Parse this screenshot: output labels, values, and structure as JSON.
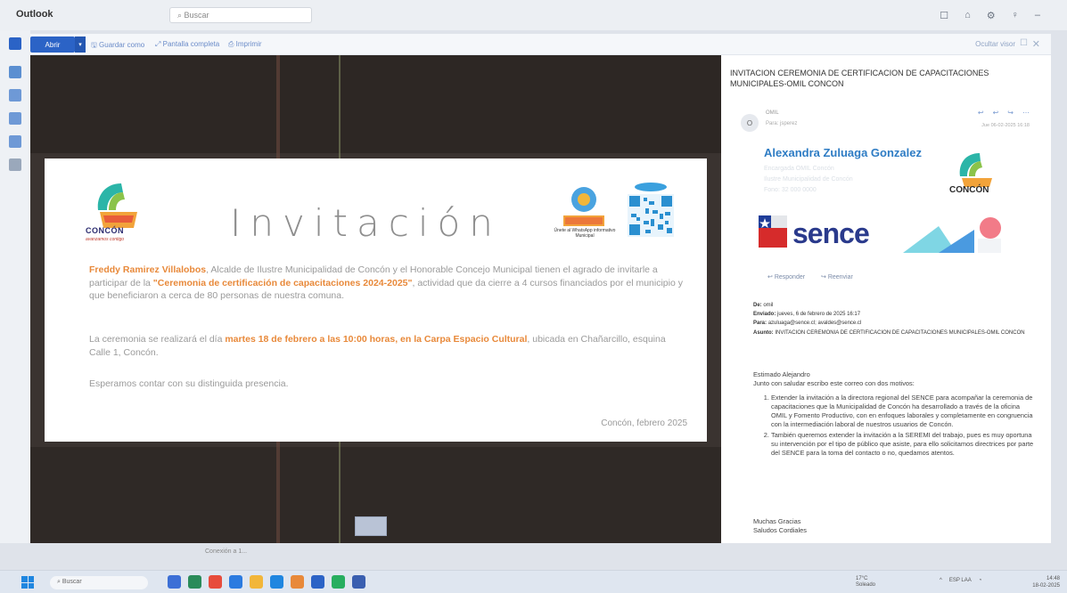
{
  "titlebar": {
    "app_title": "Outlook",
    "search_placeholder": "Buscar",
    "window_icons": [
      "☐",
      "⌂",
      "⚙",
      "♀",
      "–"
    ]
  },
  "viewer_toolbar": {
    "open_label": "Abrir",
    "save_as_label": "Guardar como",
    "fullscreen_label": "Pantalla completa",
    "print_label": "Imprimir",
    "hide_label": "Ocultar visor"
  },
  "invitation": {
    "heading": "Invitación",
    "logo_text": "CONCÓN",
    "logo_sub": "avanzamos contigo",
    "badge_text": "Únete al WhatsApp informativo Municipal",
    "p1_host": "Freddy Ramirez Villalobos",
    "p1_a": ", Alcalde de Ilustre Municipalidad de Concón y el Honorable Concejo Municipal tienen el agrado de invitarle a participar de la ",
    "p1_event": "\"Ceremonia de certificación de capacitaciones 2024-2025\"",
    "p1_b": ", actividad que da cierre a 4 cursos financiados por el municipio y que beneficiaron a cerca de 80 personas de nuestra comuna.",
    "p2_a": "La ceremonia se realizará el día ",
    "p2_when": "martes 18 de febrero a las 10:00 horas, en la Carpa Espacio Cultural",
    "p2_b": ", ubicada en Chañarcillo, esquina Calle 1, Concón.",
    "p3": "Esperamos contar con su distinguida presencia.",
    "signature": "Concón, febrero 2025"
  },
  "email": {
    "subject": "INVITACION CEREMONIA DE CERTIFICACION DE CAPACITACIONES MUNICIPALES-OMIL CONCON",
    "sender_avatar": "O",
    "sender_name": "OMIL",
    "sender_to": "Para: jsperez",
    "date": "Jue 06-02-2025 16:18",
    "action_icons": [
      "↩",
      "↩",
      "↪",
      "⋯"
    ],
    "signature_name": "Alexandra Zuluaga Gonzalez",
    "signature_faint_lines": [
      "Encargada OMIL Concón",
      "Ilustre Municipalidad de Concón",
      "Fono: 32 000 0000"
    ],
    "logo_text": "CONCÓN",
    "sence_label": "sence",
    "reply_label": "Responder",
    "forward_label": "Reenviar",
    "hdr_from_label": "De:",
    "hdr_from": "omil",
    "hdr_sent_label": "Enviado:",
    "hdr_sent": "jueves, 6 de febrero de 2025 16:17",
    "hdr_to_label": "Para:",
    "hdr_to": "azuluaga@sence.cl; avaldes@sence.cl",
    "hdr_subject_label": "Asunto:",
    "hdr_subject": "INVITACION CEREMONIA DE CERTIFICACION DE CAPACITACIONES MUNICIPALES-OMIL CONCON",
    "greeting": "Estimado Alejandro",
    "intro": "Junto con saludar escribo este correo con dos motivos:",
    "items": [
      "Extender la invitación a la directora regional del SENCE para acompañar la ceremonia de capacitaciones que la Municipalidad de Concón ha desarrollado a través de la oficina OMIL y Fomento Productivo, con en enfoques laborales y completamente en congruencia con la intermediación laboral de nuestros usuarios de Concón.",
      "También queremos extender la invitación a la SEREMI del trabajo, pues es muy oportuna su intervención por el tipo de público que asiste, para ello solicitamos directrices por parte del SENCE para la toma del contacto o no, quedamos atentos."
    ],
    "closing_1": "Muchas Gracias",
    "closing_2": "Saludos Cordiales"
  },
  "taskbar": {
    "search_placeholder": "Buscar",
    "preview_label": "Conexión a 1...",
    "weather_temp": "17°C",
    "weather_desc": "Soleado",
    "lang": "ESP LAA",
    "time": "14:48",
    "date": "18-02-2025"
  },
  "colors": {
    "accent_blue": "#2b63c6",
    "highlight_orange": "#e8893a",
    "signature_blue": "#2e7cc4"
  }
}
